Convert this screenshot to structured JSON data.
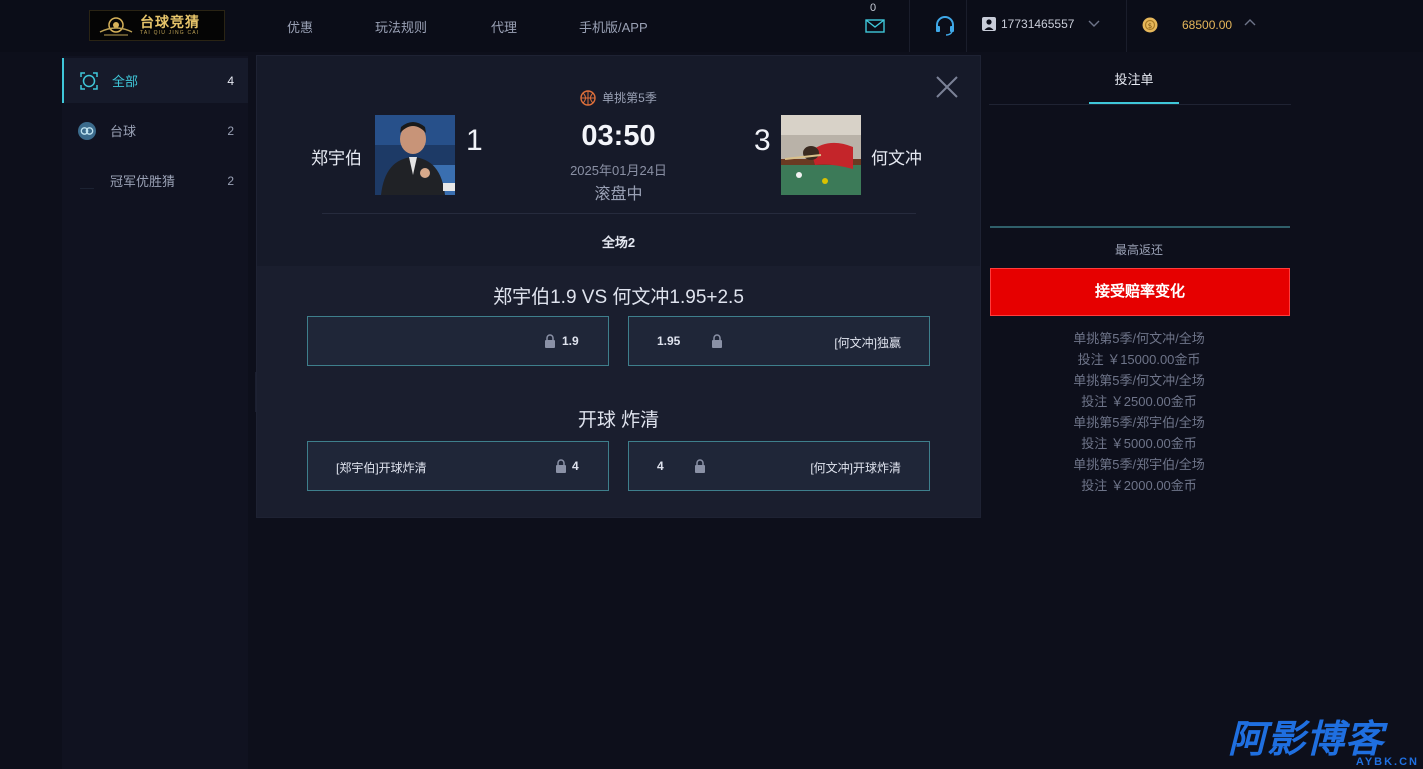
{
  "header": {
    "logo": {
      "main": "台球竞猜",
      "sub": "TAI QIU JING CAI"
    },
    "nav": [
      "优惠",
      "玩法规则",
      "代理",
      "手机版/APP"
    ],
    "mail_count": "0",
    "username": "17731465557",
    "balance": "68500.00"
  },
  "sidebar": {
    "items": [
      {
        "label": "全部",
        "count": "4",
        "icon": "target-icon"
      },
      {
        "label": "台球",
        "count": "2",
        "icon": "billiard-icon"
      },
      {
        "label": "冠军优胜猜",
        "count": "2",
        "icon": "trophy-icon"
      }
    ]
  },
  "match": {
    "league": "单挑第5季",
    "team_left": "郑宇伯",
    "team_right": "何文冲",
    "score_left": "1",
    "score_right": "3",
    "timer": "03:50",
    "date": "2025年01月24日",
    "state": "滚盘中",
    "period_tab": "全场2"
  },
  "markets": [
    {
      "title": "郑宇伯1.9 VS 何文冲1.95+2.5",
      "left": {
        "label": "",
        "odds": "1.9"
      },
      "right": {
        "label": "[何文冲]独赢",
        "odds": "1.95"
      }
    },
    {
      "title": "开球 炸清",
      "left": {
        "label": "[郑宇伯]开球炸清",
        "odds": "4"
      },
      "right": {
        "label": "[何文冲]开球炸清",
        "odds": "4"
      }
    }
  ],
  "slip": {
    "tab": "投注单",
    "max_return": "最高返还",
    "accept_button": "接受赔率变化",
    "history": [
      "单挑第5季/何文冲/全场",
      "投注 ￥15000.00金币",
      "单挑第5季/何文冲/全场",
      "投注 ￥2500.00金币",
      "单挑第5季/郑宇伯/全场",
      "投注 ￥5000.00金币",
      "单挑第5季/郑宇伯/全场",
      "投注 ￥2000.00金币"
    ]
  },
  "watermark": {
    "main": "阿影博客",
    "sub": "AYBK.CN"
  },
  "colors": {
    "accent": "#3fc7d9",
    "danger": "#e60000",
    "gold": "#e6b75a",
    "bg": "#0d0f1b"
  }
}
